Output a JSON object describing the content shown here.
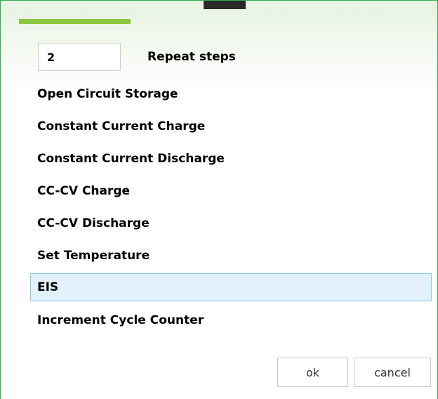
{
  "repeat": {
    "value": "2",
    "label": "Repeat steps"
  },
  "steps": [
    {
      "label": "Open Circuit Storage",
      "selected": false
    },
    {
      "label": "Constant Current Charge",
      "selected": false
    },
    {
      "label": "Constant Current Discharge",
      "selected": false
    },
    {
      "label": "CC-CV Charge",
      "selected": false
    },
    {
      "label": "CC-CV Discharge",
      "selected": false
    },
    {
      "label": "Set Temperature",
      "selected": false
    },
    {
      "label": "EIS",
      "selected": true
    },
    {
      "label": "Increment Cycle Counter",
      "selected": false
    }
  ],
  "buttons": {
    "ok": "ok",
    "cancel": "cancel"
  },
  "colors": {
    "accent": "#8cc640",
    "border": "#2fae4d",
    "selection_fill": "#e2f1fb",
    "selection_border": "#8fc8ea"
  }
}
